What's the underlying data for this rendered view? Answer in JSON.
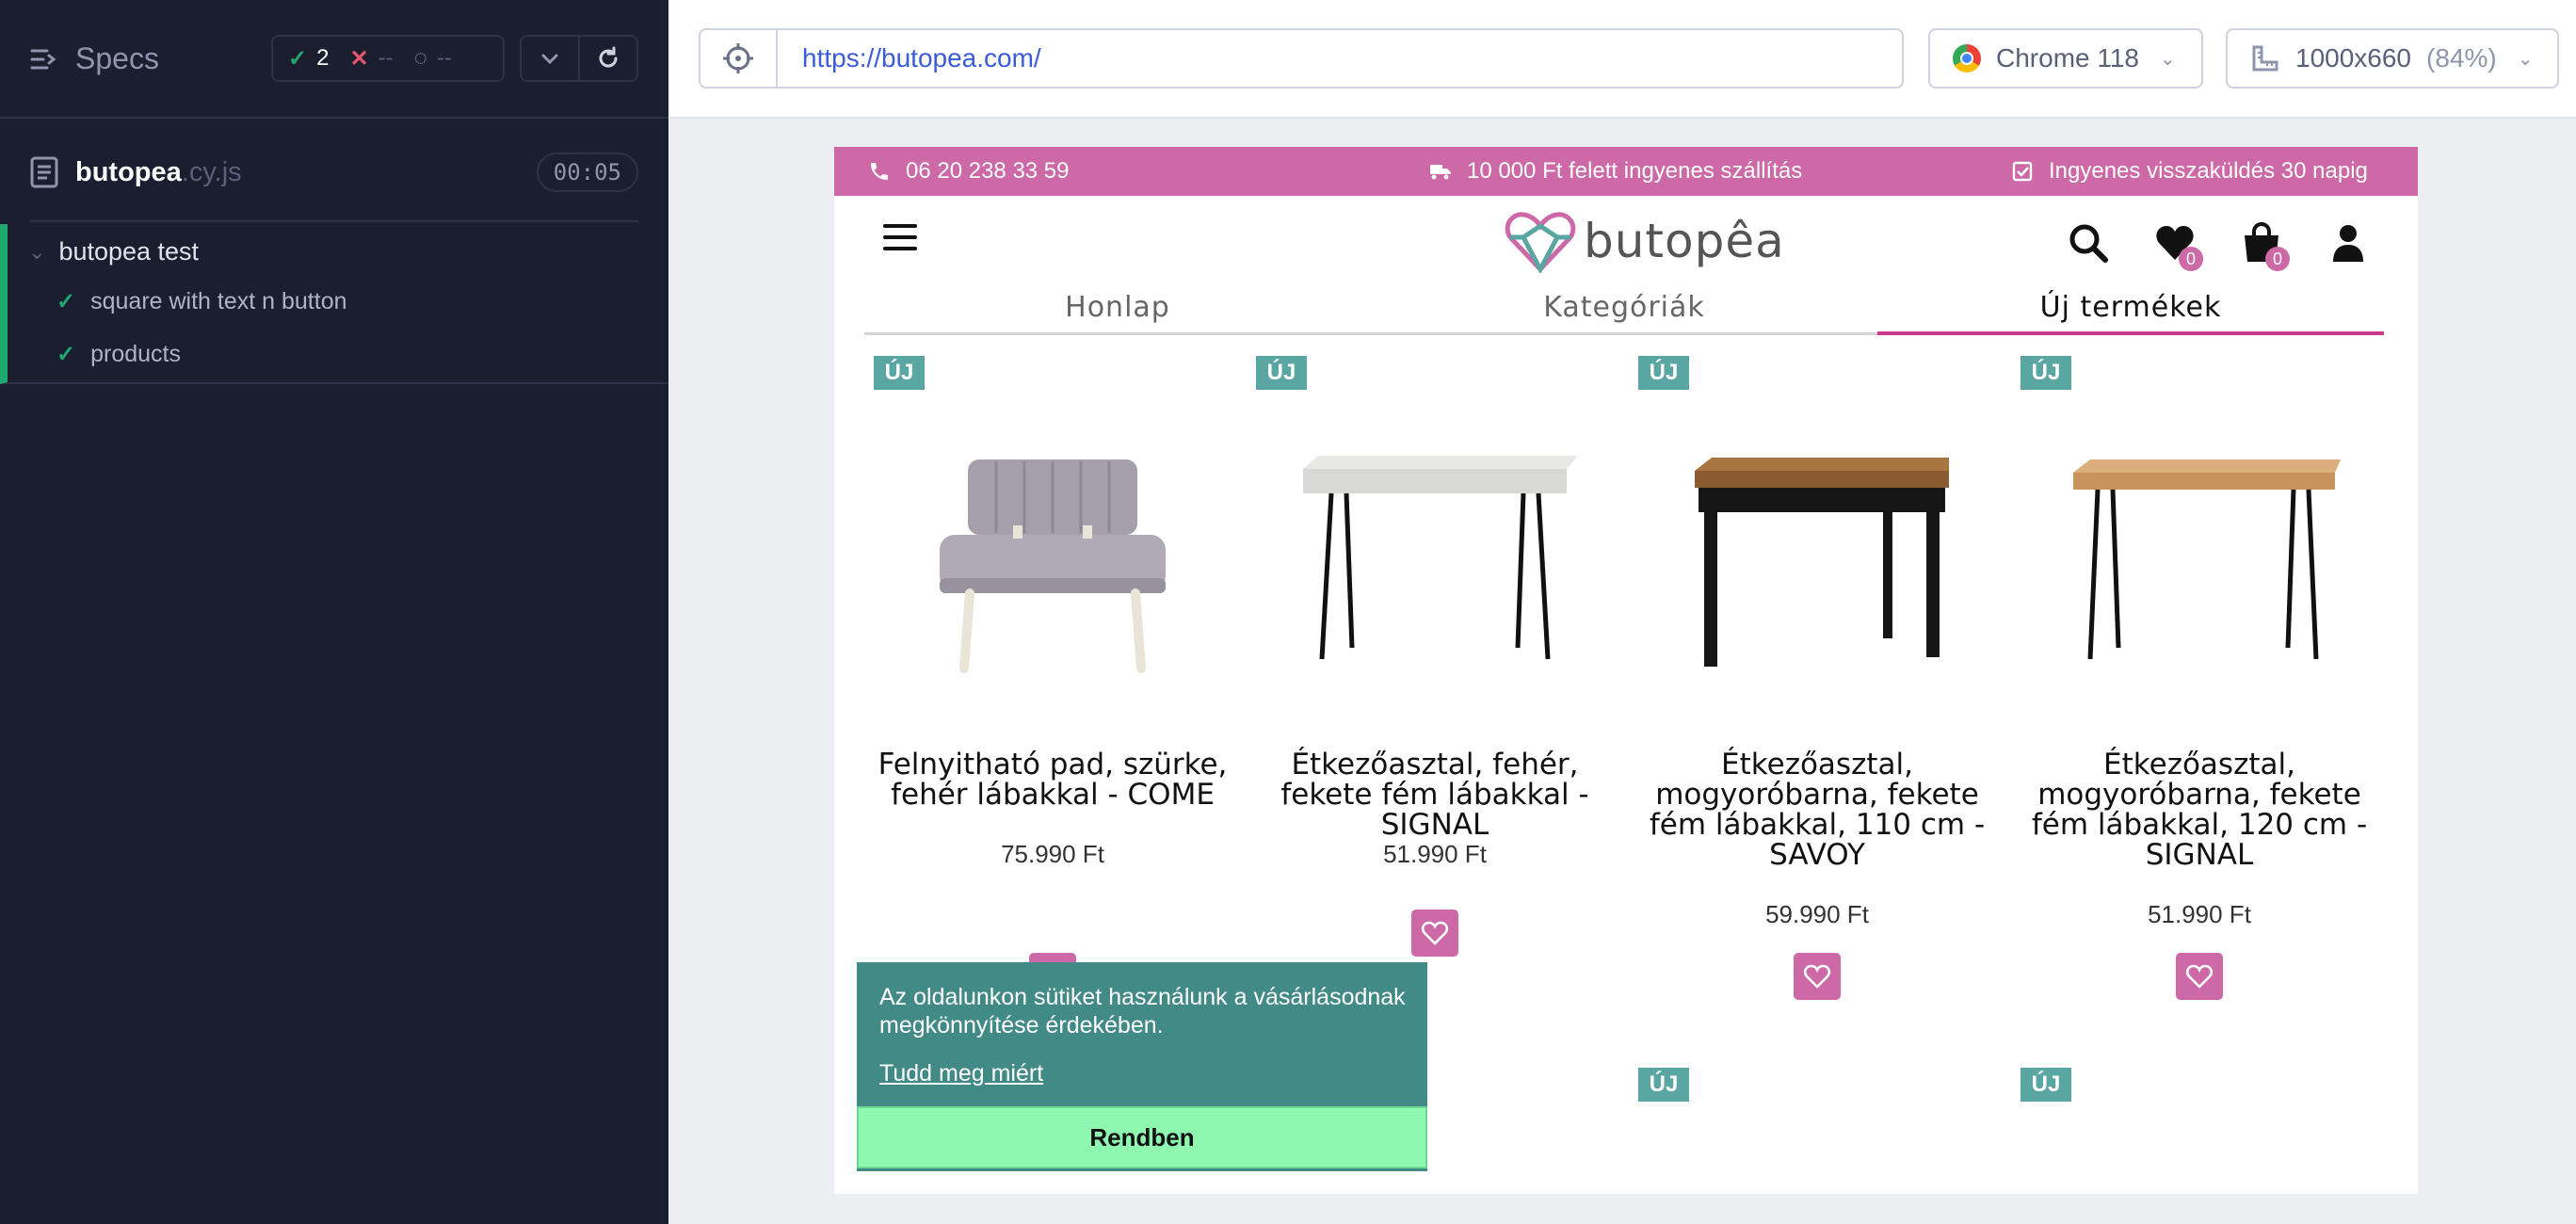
{
  "runner": {
    "specs_label": "Specs",
    "stats": {
      "passed": "2",
      "failed": "--",
      "pending": "--"
    },
    "spec_file": {
      "name": "butopea",
      "ext": ".cy.js",
      "duration": "00:05"
    },
    "suite": {
      "title": "butopea test",
      "tests": [
        {
          "title": "square with text n button"
        },
        {
          "title": "products"
        }
      ]
    }
  },
  "browser": {
    "url": "https://butopea.com/",
    "browser_label": "Chrome 118",
    "viewport_label": "1000x660",
    "viewport_scale": "(84%)"
  },
  "site": {
    "promo": {
      "phone": "06 20 238 33 59",
      "shipping": "10 000 Ft felett ingyenes szállítás",
      "returns": "Ingyenes visszaküldés 30 napig"
    },
    "logo_text": "butopêa",
    "wishlist_count": "0",
    "cart_count": "0",
    "tabs": [
      {
        "label": "Honlap"
      },
      {
        "label": "Kategóriák"
      },
      {
        "label": "Új termékek"
      }
    ],
    "new_badge": "ÚJ",
    "products": [
      {
        "name": "Felnyitható pad, szürke, fehér lábakkal - COME",
        "price": "75.990 Ft"
      },
      {
        "name": "Étkezőasztal, fehér, fekete fém lábakkal - SIGNAL",
        "price": "51.990 Ft"
      },
      {
        "name": "Étkezőasztal, mogyoróbarna, fekete fém lábakkal, 110 cm - SAVOY",
        "price": "59.990 Ft"
      },
      {
        "name": "Étkezőasztal, mogyoróbarna, fekete fém lábakkal, 120 cm - SIGNAL",
        "price": "51.990 Ft"
      }
    ],
    "cookie": {
      "text": "Az oldalunkon sütiket használunk a vásárlásodnak megkönnyítése érdekében.",
      "link": "Tudd meg miért",
      "button": "Rendben"
    }
  },
  "colors": {
    "accent": "#cc69a6",
    "badge_teal": "#5aa6a2",
    "cookie_bg": "#428a86",
    "cookie_button": "#8ef7b0",
    "runner_bg": "#1b1e2e",
    "pass": "#1fa971"
  }
}
